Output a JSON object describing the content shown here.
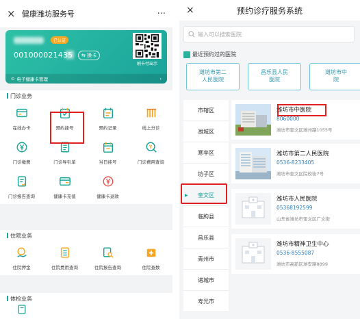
{
  "left": {
    "header": {
      "close": "×",
      "title": "健康潍坊服务号",
      "more": "···"
    },
    "card": {
      "verified": "已认证",
      "number": "001000021435",
      "switch_label": "⇆ 换卡",
      "qr_caption": "刷卡付出示",
      "manage_label": "电子健康卡管理",
      "manage_arrow": "›"
    },
    "sections": [
      {
        "title": "门诊业务",
        "items": [
          {
            "label": "在线办卡",
            "icon": "card-icon"
          },
          {
            "label": "预约挂号",
            "icon": "calendar-check-icon"
          },
          {
            "label": "预约记录",
            "icon": "calendar-list-icon"
          },
          {
            "label": "线上分诊",
            "icon": "bars-icon"
          },
          {
            "label": "门诊缴费",
            "icon": "yen-icon"
          },
          {
            "label": "门诊导引单",
            "icon": "document-icon"
          },
          {
            "label": "当日挂号",
            "icon": "calendar-icon"
          },
          {
            "label": "门诊费用查询",
            "icon": "search-yen-icon"
          },
          {
            "label": "门诊报告查询",
            "icon": "report-icon"
          },
          {
            "label": "健康卡充值",
            "icon": "card-recharge-icon"
          },
          {
            "label": "健康卡退款",
            "icon": "refund-icon"
          }
        ]
      },
      {
        "title": "住院业务",
        "items": [
          {
            "label": "住院押金",
            "icon": "deposit-icon"
          },
          {
            "label": "住院费用查询",
            "icon": "ledger-icon"
          },
          {
            "label": "住院报告查询",
            "icon": "report-search-icon"
          },
          {
            "label": "住院查数",
            "icon": "medical-kit-icon"
          }
        ]
      },
      {
        "title": "体检业务",
        "items": []
      }
    ],
    "colors": {
      "accent": "#1aa39a",
      "orange": "#f5a623",
      "highlight": "#e02020"
    }
  },
  "right": {
    "header": {
      "close": "×",
      "title": "预约诊疗服务系统"
    },
    "search": {
      "placeholder": "输入可以搜索医院"
    },
    "recent": {
      "title": "最近预约过的医院",
      "chips": [
        "潍坊市第二\n人民医院",
        "昌乐县人民\n医院",
        "潍坊市中\n院"
      ]
    },
    "districts": [
      {
        "name": "市辖区",
        "selected": false
      },
      {
        "name": "潍城区",
        "selected": false
      },
      {
        "name": "寒亭区",
        "selected": false
      },
      {
        "name": "坊子区",
        "selected": false
      },
      {
        "name": "奎文区",
        "selected": true
      },
      {
        "name": "临朐县",
        "selected": false
      },
      {
        "name": "昌乐县",
        "selected": false
      },
      {
        "name": "青州市",
        "selected": false
      },
      {
        "name": "诸城市",
        "selected": false
      },
      {
        "name": "寿光市",
        "selected": false
      }
    ],
    "selected_marker": "▶",
    "hospitals": [
      {
        "name": "潍坊市中医院",
        "tel": "8060000",
        "addr": "潍坊市奎文区潍州路1055号"
      },
      {
        "name": "潍坊市第二人民医院",
        "tel": "0536-8233405",
        "addr": "潍坊市奎文区院校街7号"
      },
      {
        "name": "潍坊市人民医院",
        "tel": "05368192599",
        "addr": "山东省潍坊市奎文区广文街"
      },
      {
        "name": "潍坊市精神卫生中心",
        "tel": "0536-8555087",
        "addr": "潍坊市高新区潍安路8899"
      }
    ]
  }
}
